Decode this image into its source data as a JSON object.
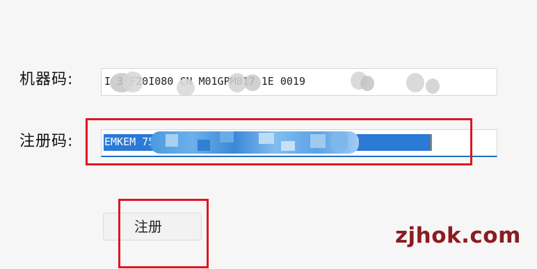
{
  "form": {
    "machine_code_label": "机器码:",
    "machine_code_value": "I        3FF20I080  CN   M01GPM017  1E  0019",
    "registration_code_label": "注册码:",
    "registration_code_value": "EMKEM                              75E433538",
    "register_button_label": "注册"
  },
  "watermark": {
    "text": "zjhok.com"
  },
  "colors": {
    "selection": "#2b7ad6",
    "focus_border": "#1f6fc2",
    "annotation_red": "#e0141e",
    "watermark": "#8b1c20"
  }
}
